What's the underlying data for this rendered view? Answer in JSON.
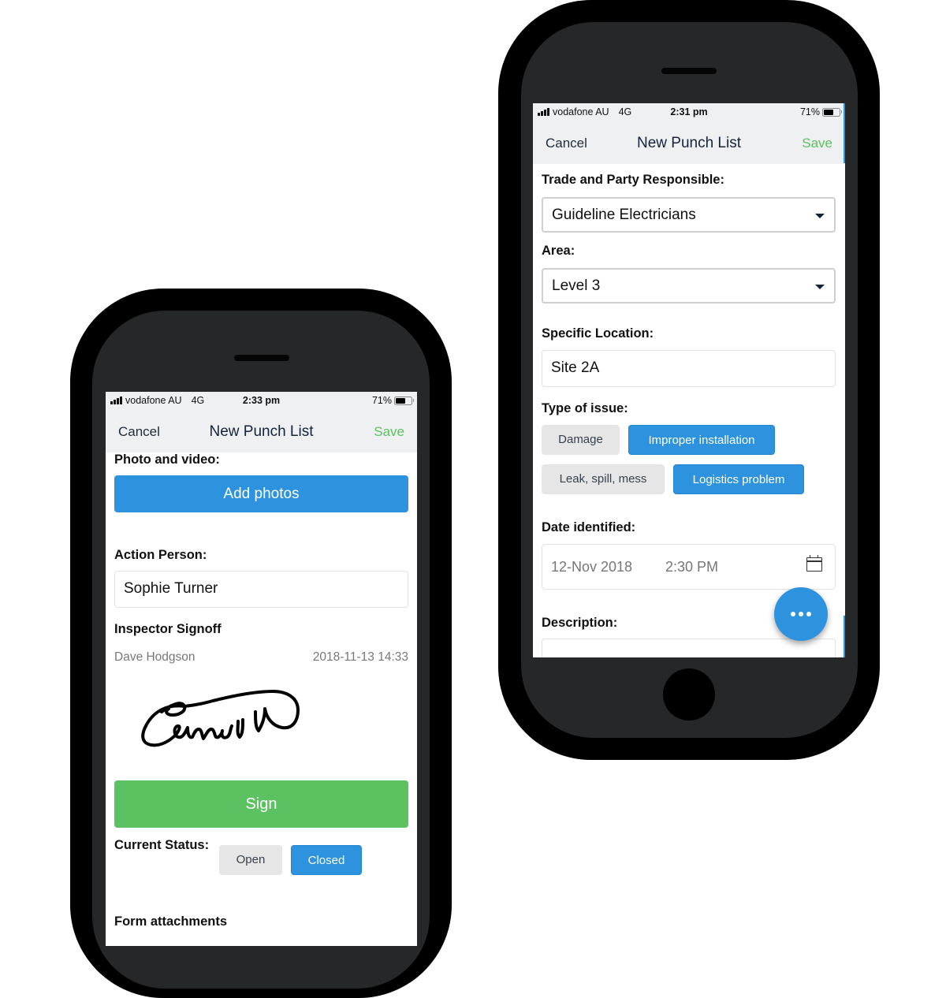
{
  "right_phone": {
    "status_bar": {
      "signal_icon": "signal-bars-icon",
      "carrier": "vodafone AU",
      "network": "4G",
      "time": "2:31 pm",
      "battery_percent": "71%",
      "battery_level": 0.71,
      "battery_icon": "battery-icon"
    },
    "nav": {
      "cancel": "Cancel",
      "title": "New Punch List",
      "save": "Save"
    },
    "form": {
      "trade_label": "Trade and Party Responsible:",
      "trade_value": "Guideline Electricians",
      "area_label": "Area:",
      "area_value": "Level 3",
      "location_label": "Specific Location:",
      "location_value": "Site 2A",
      "issue_label": "Type of issue:",
      "issue_options": [
        {
          "label": "Damage",
          "selected": false
        },
        {
          "label": "Improper installation",
          "selected": true
        },
        {
          "label": "Leak, spill, mess",
          "selected": false
        },
        {
          "label": "Logistics problem",
          "selected": true
        }
      ],
      "date_label": "Date identified:",
      "date_value": "12-Nov 2018",
      "time_value": "2:30 PM",
      "calendar_icon": "calendar-icon",
      "description_label": "Description:",
      "fab_icon": "more-horizontal-icon"
    }
  },
  "left_phone": {
    "status_bar": {
      "signal_icon": "signal-bars-icon",
      "carrier": "vodafone AU",
      "network": "4G",
      "time": "2:33 pm",
      "battery_percent": "71%",
      "battery_level": 0.71,
      "battery_icon": "battery-icon"
    },
    "nav": {
      "cancel": "Cancel",
      "title": "New Punch List",
      "save": "Save"
    },
    "form": {
      "photo_label": "Photo and video:",
      "add_photos": "Add photos",
      "action_person_label": "Action Person:",
      "action_person_value": "Sophie Turner",
      "signoff_label": "Inspector Signoff",
      "signoff_name": "Dave Hodgson",
      "signoff_datetime": "2018-11-13 14:33",
      "sign_button": "Sign",
      "status_label": "Current Status:",
      "status_options": [
        {
          "label": "Open",
          "selected": false
        },
        {
          "label": "Closed",
          "selected": true
        }
      ],
      "attachments_label": "Form attachments"
    }
  },
  "colors": {
    "accent_blue": "#2e93de",
    "save_green": "#5cc160",
    "chip_gray": "#e6e6e6",
    "nav_bg": "#eff0f2",
    "phone_body": "#262728"
  }
}
